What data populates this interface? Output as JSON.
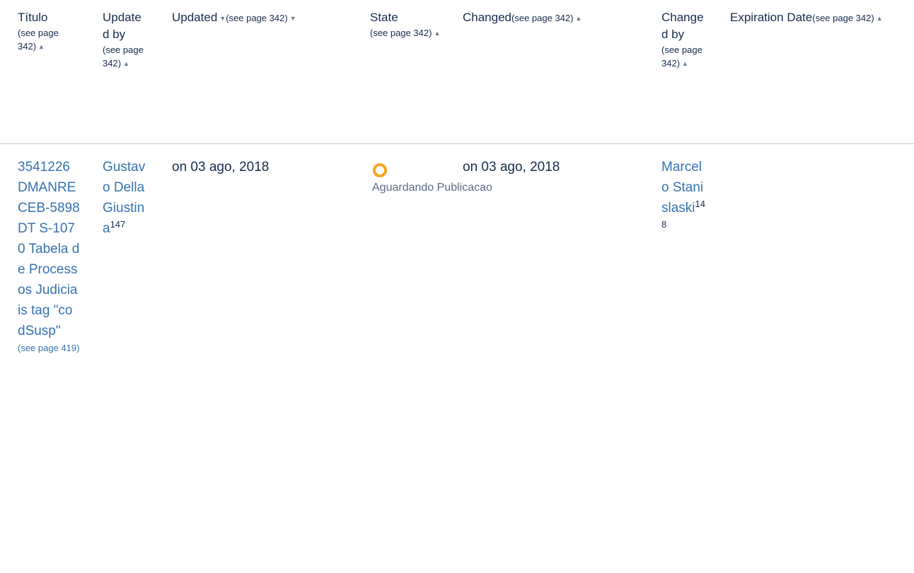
{
  "table": {
    "headers": {
      "titulo": {
        "label": "Título",
        "see": "(see page 342)"
      },
      "updated_by": {
        "label": "Updated by",
        "see": "(see page 342)"
      },
      "updated": {
        "label": "Updated",
        "see": "(see page 342)"
      },
      "state": {
        "label": "State",
        "see": "(see page 342)"
      },
      "changed": {
        "label": "Changed",
        "see": "(see page 342)"
      },
      "changed_by": {
        "label": "Changed by",
        "see": "(see page 342)"
      },
      "expiration": {
        "label": "Expiration Date",
        "see": "(see page 342)"
      }
    },
    "sort_icons": {
      "up": "▲",
      "down": "▼"
    },
    "row": {
      "title": "3541226 DMANRECEB-5898 DT S-1070 Tabela de Processos Judiciais tag \"codSusp\"",
      "title_see": "(see page 419)",
      "updated_by": "Gustavo Della Giustina",
      "updated_by_ref": "147",
      "updated": "on 03 ago, 2018",
      "state": "Aguardando Publicacao",
      "state_color": "#f6a623",
      "changed": "on 03 ago, 2018",
      "changed_by": "Marcelo Stanislaski",
      "changed_by_ref": "148",
      "expiration": ""
    }
  }
}
